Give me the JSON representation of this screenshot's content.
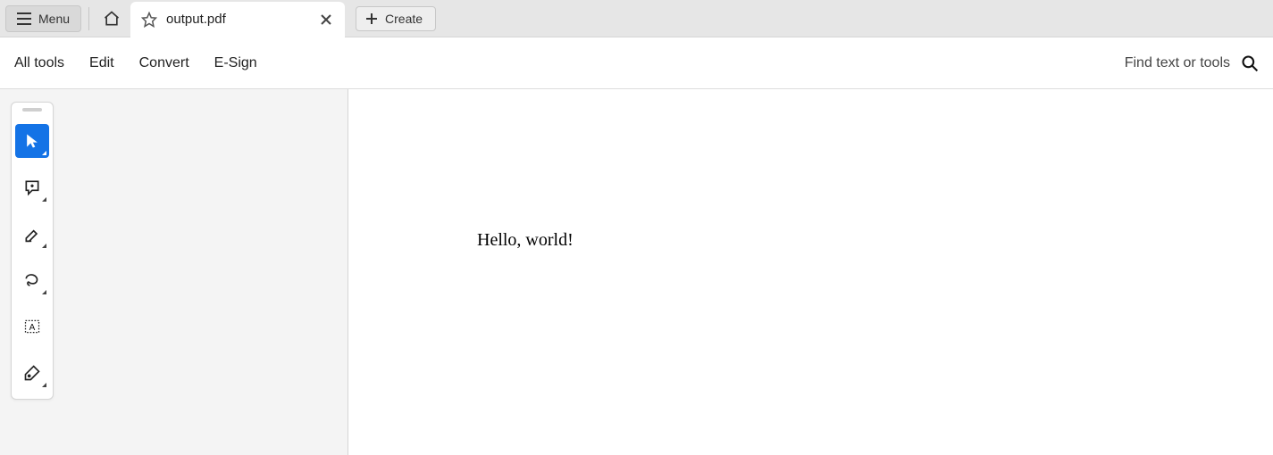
{
  "header": {
    "menu_label": "Menu",
    "tab_title": "output.pdf",
    "create_label": "Create"
  },
  "menubar": {
    "items": [
      "All tools",
      "Edit",
      "Convert",
      "E-Sign"
    ],
    "find_label": "Find text or tools"
  },
  "toolstrip": {
    "tools": [
      {
        "name": "select-tool",
        "active": true
      },
      {
        "name": "comment-tool",
        "active": false
      },
      {
        "name": "highlight-tool",
        "active": false
      },
      {
        "name": "draw-tool",
        "active": false
      },
      {
        "name": "text-box-tool",
        "active": false
      },
      {
        "name": "sign-tool",
        "active": false
      }
    ]
  },
  "document": {
    "content": "Hello, world!"
  }
}
